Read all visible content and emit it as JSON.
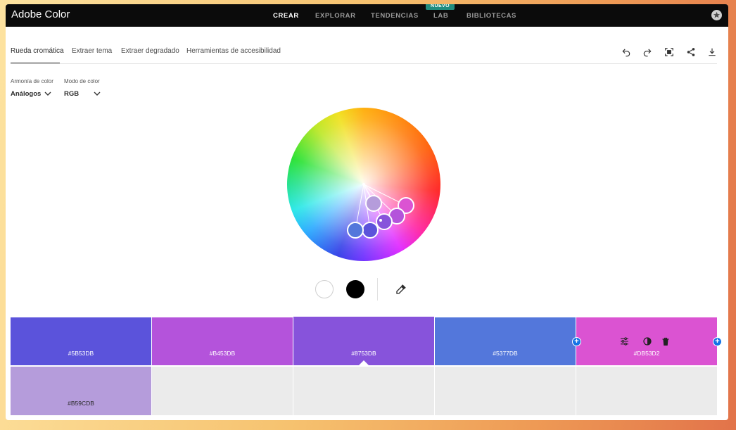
{
  "app": {
    "title": "Adobe Color"
  },
  "nav": {
    "items": [
      {
        "label": "CREAR",
        "active": true
      },
      {
        "label": "EXPLORAR",
        "active": false
      },
      {
        "label": "TENDENCIAS",
        "active": false
      },
      {
        "label": "LAB",
        "active": false,
        "badge": "NUEVO"
      },
      {
        "label": "BIBLIOTECAS",
        "active": false
      }
    ]
  },
  "tabs": [
    {
      "label": "Rueda cromática",
      "active": true
    },
    {
      "label": "Extraer tema",
      "active": false
    },
    {
      "label": "Extraer degradado",
      "active": false
    },
    {
      "label": "Herramientas de accesibilidad",
      "active": false
    }
  ],
  "toolbar": {
    "icons": [
      "undo-icon",
      "redo-icon",
      "fullscreen-icon",
      "share-icon",
      "download-icon"
    ]
  },
  "harmony": {
    "label": "Armonía de color",
    "value": "Análogos"
  },
  "mode": {
    "label": "Modo de color",
    "value": "RGB"
  },
  "swatch_controls": {
    "icons": [
      "white-swatch",
      "black-swatch",
      "eyedropper-icon"
    ]
  },
  "palette": {
    "row1": [
      {
        "hex": "#5B53DB",
        "color": "#5b53db"
      },
      {
        "hex": "#B453DB",
        "color": "#b453db"
      },
      {
        "hex": "#8753DB",
        "color": "#8753db",
        "selected": true
      },
      {
        "hex": "#5377DB",
        "color": "#5377db"
      },
      {
        "hex": "#DB53D2",
        "color": "#db53d2"
      }
    ],
    "row2": [
      {
        "hex": "#B59CDB",
        "color": "#b59cdb"
      }
    ]
  }
}
